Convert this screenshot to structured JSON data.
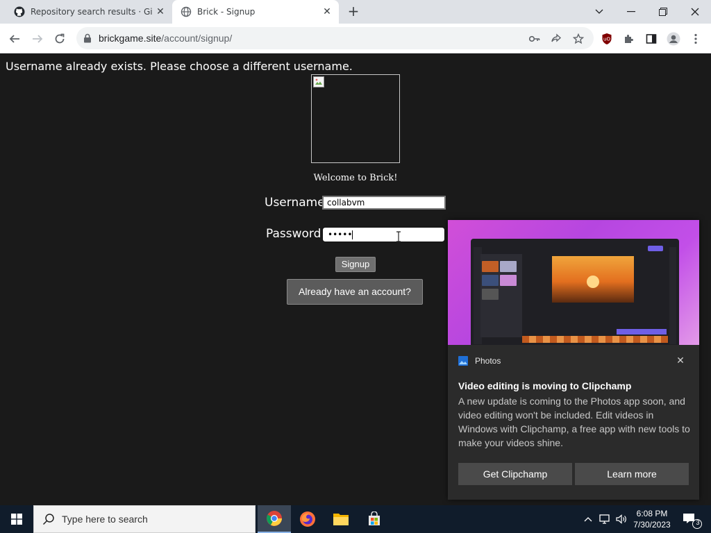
{
  "browser": {
    "tabs": [
      {
        "title": "Repository search results · GitHub",
        "active": false,
        "icon": "github-icon"
      },
      {
        "title": "Brick - Signup",
        "active": true,
        "icon": "globe-icon"
      }
    ],
    "url_domain": "brickgame.site",
    "url_path": "/account/signup/"
  },
  "page": {
    "error_message": "Username already exists. Please choose a different username.",
    "welcome_text": "Welcome to Brick!",
    "username_label": "Username:",
    "username_value": "collabvm",
    "password_label": "Password:",
    "password_value": "•••••",
    "signup_button": "Signup",
    "login_button": "Already have an account?"
  },
  "toast": {
    "app_name": "Photos",
    "title": "Video editing is moving to Clipchamp",
    "body": "A new update is coming to the Photos app soon, and video editing won't be included. Edit videos in Windows with Clipchamp, a free app with new tools to make your videos shine.",
    "primary_button": "Get Clipchamp",
    "secondary_button": "Learn more"
  },
  "taskbar": {
    "search_placeholder": "Type here to search",
    "time": "6:08 PM",
    "date": "7/30/2023",
    "notification_count": "3"
  },
  "colors": {
    "page_background": "#1a1a1a",
    "taskbar": "#101c2b",
    "toast_background": "#2b2b2b",
    "accent_purple": "#c24fe8"
  }
}
